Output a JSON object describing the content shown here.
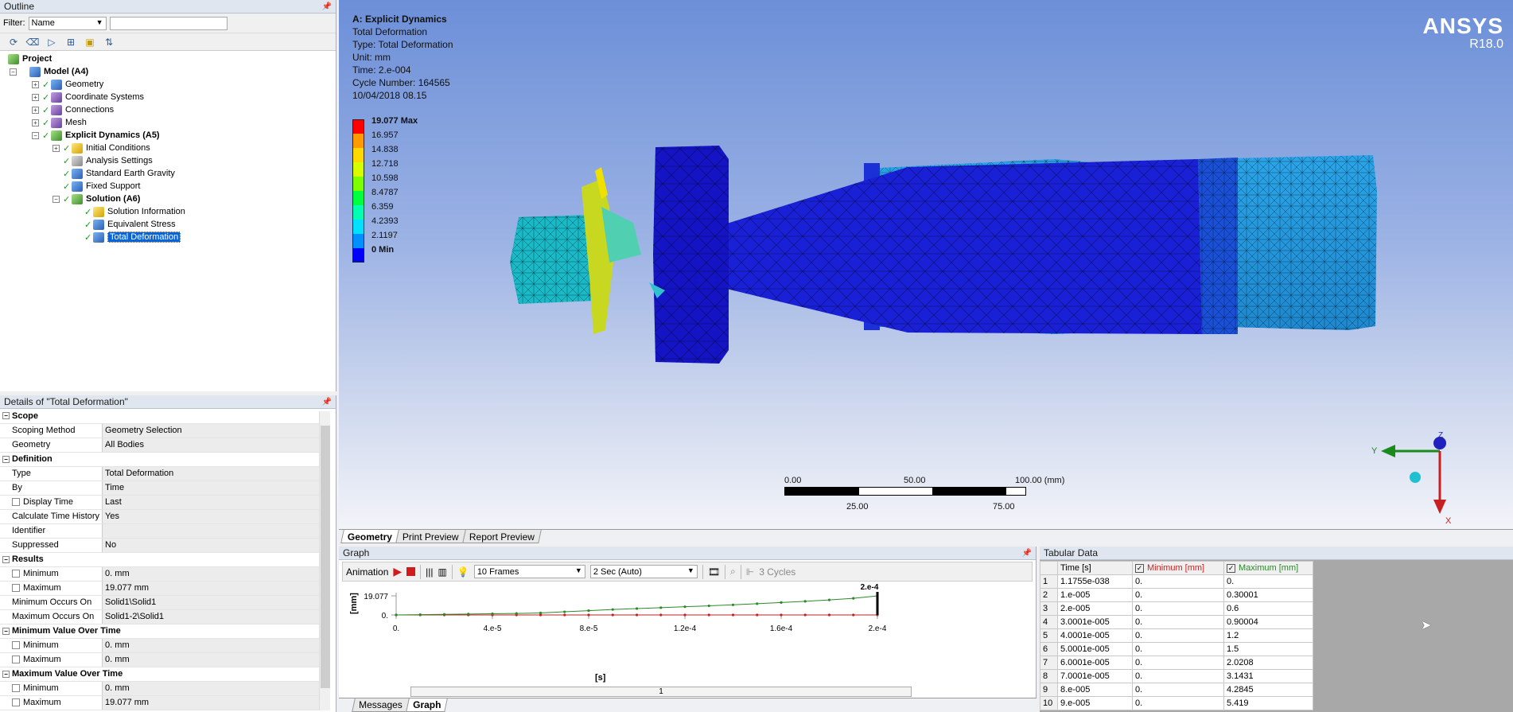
{
  "outline": {
    "title": "Outline",
    "filter_label": "Filter:",
    "filter_value": "Name",
    "tree": {
      "project": "Project",
      "model": "Model (A4)",
      "geometry": "Geometry",
      "coordinate_systems": "Coordinate Systems",
      "connections": "Connections",
      "mesh": "Mesh",
      "explicit_dynamics": "Explicit Dynamics (A5)",
      "initial_conditions": "Initial Conditions",
      "analysis_settings": "Analysis Settings",
      "standard_earth_gravity": "Standard Earth Gravity",
      "fixed_support": "Fixed Support",
      "solution": "Solution (A6)",
      "solution_information": "Solution Information",
      "equivalent_stress": "Equivalent Stress",
      "total_deformation": "Total Deformation"
    }
  },
  "details": {
    "title": "Details of \"Total Deformation\"",
    "scope": {
      "label": "Scope",
      "scoping_method_k": "Scoping Method",
      "scoping_method_v": "Geometry Selection",
      "geometry_k": "Geometry",
      "geometry_v": "All Bodies"
    },
    "definition": {
      "label": "Definition",
      "type_k": "Type",
      "type_v": "Total Deformation",
      "by_k": "By",
      "by_v": "Time",
      "display_time_k": "Display Time",
      "display_time_v": "Last",
      "calc_k": "Calculate Time History",
      "calc_v": "Yes",
      "identifier_k": "Identifier",
      "identifier_v": "",
      "suppressed_k": "Suppressed",
      "suppressed_v": "No"
    },
    "results": {
      "label": "Results",
      "minimum_k": "Minimum",
      "minimum_v": "0. mm",
      "maximum_k": "Maximum",
      "maximum_v": "19.077 mm",
      "min_occurs_k": "Minimum Occurs On",
      "min_occurs_v": "Solid1\\Solid1",
      "max_occurs_k": "Maximum Occurs On",
      "max_occurs_v": "Solid1-2\\Solid1"
    },
    "min_over_time": {
      "label": "Minimum Value Over Time",
      "minimum_k": "Minimum",
      "minimum_v": "0. mm",
      "maximum_k": "Maximum",
      "maximum_v": "0. mm"
    },
    "max_over_time": {
      "label": "Maximum Value Over Time",
      "minimum_k": "Minimum",
      "minimum_v": "0. mm",
      "maximum_k": "Maximum",
      "maximum_v": "19.077 mm"
    }
  },
  "viewport": {
    "info": [
      "A: Explicit Dynamics",
      "Total Deformation",
      "Type: Total Deformation",
      "Unit: mm",
      "Time: 2.e-004",
      "Cycle Number: 164565",
      "10/04/2018 08.15"
    ],
    "legend": [
      {
        "label": "19.077 Max",
        "color": "#ff0000",
        "bold": true
      },
      {
        "label": "16.957",
        "color": "#ff9a00",
        "bold": false
      },
      {
        "label": "14.838",
        "color": "#ffd800",
        "bold": false
      },
      {
        "label": "12.718",
        "color": "#d8ff00",
        "bold": false
      },
      {
        "label": "10.598",
        "color": "#7dff00",
        "bold": false
      },
      {
        "label": "8.4787",
        "color": "#00ff40",
        "bold": false
      },
      {
        "label": "6.359",
        "color": "#00ffb0",
        "bold": false
      },
      {
        "label": "4.2393",
        "color": "#00e0ff",
        "bold": false
      },
      {
        "label": "2.1197",
        "color": "#0090ff",
        "bold": false
      },
      {
        "label": "0 Min",
        "color": "#0000ff",
        "bold": true
      }
    ],
    "brand": "ANSYS",
    "version": "R18.0",
    "scale": {
      "l0": "0.00",
      "l50": "50.00",
      "l100": "100.00 (mm)",
      "l25": "25.00",
      "l75": "75.00"
    },
    "axes": {
      "y": "Y",
      "z": "Z",
      "x": "X"
    },
    "tabs": [
      "Geometry",
      "Print Preview",
      "Report Preview"
    ]
  },
  "graph": {
    "title": "Graph",
    "animation_label": "Animation",
    "frames": "10 Frames",
    "speed": "2 Sec (Auto)",
    "cycles": "3 Cycles",
    "ylabel": "[mm]",
    "xlabel": "[s]",
    "y_ticks": [
      "19.077",
      "0."
    ],
    "x_ticks": [
      "0.",
      "4.e-5",
      "8.e-5",
      "1.2e-4",
      "1.6e-4",
      "2.e-4"
    ],
    "marker_label": "2.e-4",
    "slider_value": "1",
    "tabs": [
      "Messages",
      "Graph"
    ]
  },
  "chart_data": {
    "type": "line",
    "xlabel": "[s]",
    "ylabel": "[mm]",
    "xlim": [
      0,
      0.0002
    ],
    "ylim": [
      0,
      19.077
    ],
    "series": [
      {
        "name": "Minimum [mm]",
        "color": "#c22222",
        "x": [
          0,
          1e-05,
          2e-05,
          3e-05,
          4e-05,
          5e-05,
          6e-05,
          7e-05,
          8e-05,
          9e-05,
          0.0001,
          0.00011,
          0.00012,
          0.00013,
          0.00014,
          0.00015,
          0.00016,
          0.00017,
          0.00018,
          0.00019,
          0.0002
        ],
        "values": [
          0,
          0,
          0,
          0,
          0,
          0,
          0,
          0,
          0,
          0,
          0,
          0,
          0,
          0,
          0,
          0,
          0,
          0,
          0,
          0,
          0
        ]
      },
      {
        "name": "Maximum [mm]",
        "color": "#2a8a2a",
        "x": [
          0,
          1e-05,
          2e-05,
          3e-05,
          4e-05,
          5e-05,
          6e-05,
          7e-05,
          8e-05,
          9e-05,
          0.0001,
          0.00011,
          0.00012,
          0.00013,
          0.00014,
          0.00015,
          0.00016,
          0.00017,
          0.00018,
          0.00019,
          0.0002
        ],
        "values": [
          0,
          0.30001,
          0.6,
          0.90004,
          1.2,
          1.5,
          2.0208,
          3.1431,
          4.2845,
          5.419,
          6.4,
          7.3,
          8.2,
          9.1,
          10.1,
          11.2,
          12.4,
          13.6,
          15.0,
          16.6,
          19.077
        ]
      }
    ]
  },
  "tabular": {
    "title": "Tabular Data",
    "headers": [
      "Time [s]",
      "Minimum [mm]",
      "Maximum [mm]"
    ],
    "rows": [
      [
        "1",
        "1.1755e-038",
        "0.",
        "0."
      ],
      [
        "2",
        "1.e-005",
        "0.",
        "0.30001"
      ],
      [
        "3",
        "2.e-005",
        "0.",
        "0.6"
      ],
      [
        "4",
        "3.0001e-005",
        "0.",
        "0.90004"
      ],
      [
        "5",
        "4.0001e-005",
        "0.",
        "1.2"
      ],
      [
        "6",
        "5.0001e-005",
        "0.",
        "1.5"
      ],
      [
        "7",
        "6.0001e-005",
        "0.",
        "2.0208"
      ],
      [
        "8",
        "7.0001e-005",
        "0.",
        "3.1431"
      ],
      [
        "9",
        "8.e-005",
        "0.",
        "4.2845"
      ],
      [
        "10",
        "9.e-005",
        "0.",
        "5.419"
      ]
    ]
  }
}
